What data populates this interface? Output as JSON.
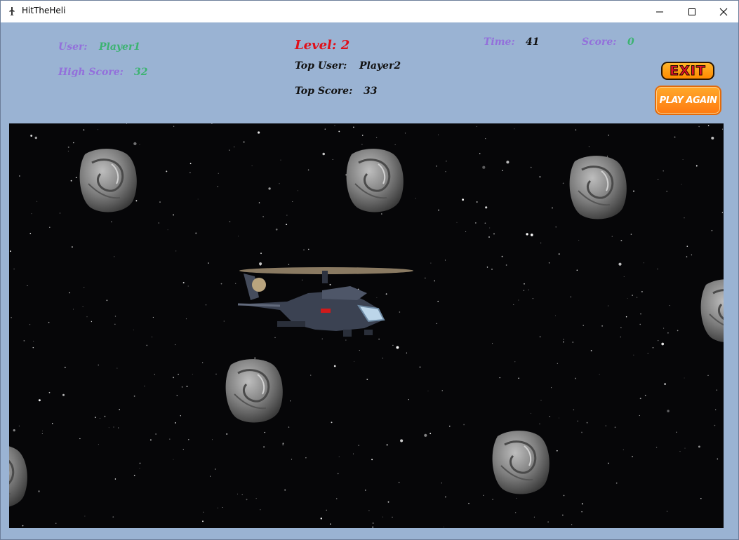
{
  "window": {
    "title": "HitTheHeli",
    "icon": "heli-app-icon",
    "controls": [
      "minimize-icon",
      "maximize-icon",
      "close-icon"
    ]
  },
  "hud": {
    "user_label": "User:",
    "user_value": "Player1",
    "high_score_label": "High Score:",
    "high_score_value": "32",
    "level_text": "Level: 2",
    "top_user_label": "Top User:",
    "top_user_value": "Player2",
    "top_score_label": "Top Score:",
    "top_score_value": "33",
    "time_label": "Time:",
    "time_value": "41",
    "score_label": "Score:",
    "score_value": "0"
  },
  "buttons": {
    "exit_label": "EXIT",
    "play_again_label": "PLAY AGAIN"
  },
  "colors": {
    "background": "#9ab3d3",
    "label_purple": "#9370db",
    "value_green": "#3cb371",
    "level_red": "#e0101a",
    "button_orange": "#ff8a00"
  },
  "game": {
    "sprites": [
      "helicopter",
      "asteroid",
      "asteroid",
      "asteroid",
      "asteroid",
      "asteroid",
      "asteroid",
      "asteroid",
      "asteroid"
    ]
  }
}
